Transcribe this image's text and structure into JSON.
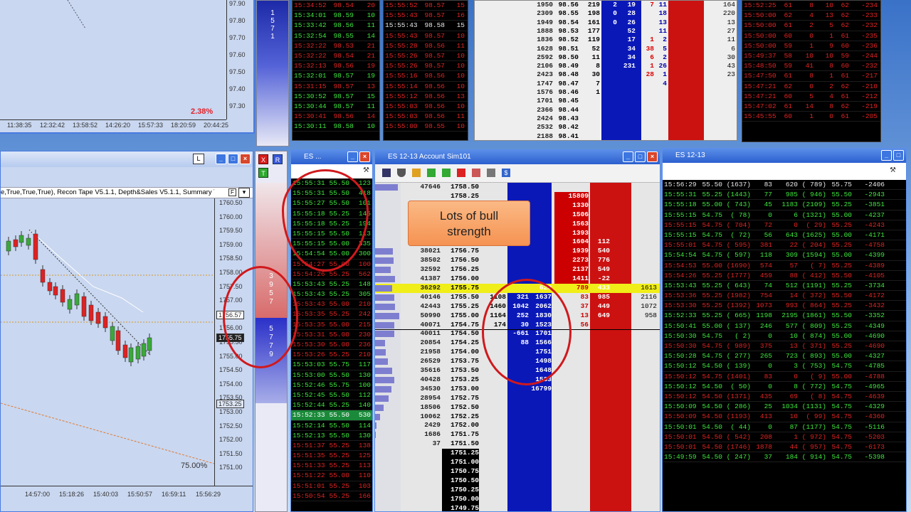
{
  "top_chart": {
    "prices": [
      "97.90",
      "97.80",
      "97.70",
      "97.60",
      "97.50",
      "97.40",
      "97.30"
    ],
    "times": [
      "11:38:35",
      "12:32:42",
      "13:58:52",
      "14:26:20",
      "15:57:33",
      "18:20:59",
      "20:44:25"
    ],
    "pct": "2.38%"
  },
  "top_tape_1": [
    [
      "15:34:52",
      "98.54",
      "20",
      "r"
    ],
    [
      "15:34:01",
      "98.59",
      "10",
      "g"
    ],
    [
      "15:33:42",
      "98.56",
      "11",
      "g"
    ],
    [
      "15:32:54",
      "98.55",
      "14",
      "g"
    ],
    [
      "15:32:22",
      "98.53",
      "21",
      "r"
    ],
    [
      "15:32:22",
      "98.54",
      "21",
      "r"
    ],
    [
      "15:32:13",
      "98.56",
      "19",
      "r"
    ],
    [
      "15:32:01",
      "98.57",
      "19",
      "g"
    ],
    [
      "15:31:15",
      "98.57",
      "13",
      "r"
    ],
    [
      "15:30:52",
      "98.57",
      "15",
      "g"
    ],
    [
      "15:30:44",
      "98.57",
      "11",
      "g"
    ],
    [
      "15:30:41",
      "98.56",
      "14",
      "r"
    ],
    [
      "15:30:11",
      "98.58",
      "10",
      "g"
    ]
  ],
  "top_tape_2": [
    [
      "15:55:52",
      "98.57",
      "15",
      "r"
    ],
    [
      "15:55:43",
      "98.57",
      "16",
      "r"
    ],
    [
      "15:55:43",
      "98.58",
      "15",
      "w"
    ],
    [
      "15:55:43",
      "98.57",
      "10",
      "r"
    ],
    [
      "15:55:28",
      "98.56",
      "11",
      "r"
    ],
    [
      "15:55:26",
      "98.57",
      "10",
      "r"
    ],
    [
      "15:55:26",
      "98.57",
      "10",
      "r"
    ],
    [
      "15:55:16",
      "98.56",
      "10",
      "r"
    ],
    [
      "15:55:14",
      "98.56",
      "10",
      "r"
    ],
    [
      "15:55:12",
      "98.56",
      "13",
      "r"
    ],
    [
      "15:55:03",
      "98.56",
      "10",
      "r"
    ],
    [
      "15:55:03",
      "98.56",
      "11",
      "r"
    ],
    [
      "15:55:00",
      "98.55",
      "10",
      "r"
    ]
  ],
  "top_ladder": [
    [
      "1950",
      "98.56",
      "219",
      "2",
      "19",
      "7",
      "11"
    ],
    [
      "2309",
      "98.55",
      "198",
      "0",
      "28",
      "",
      "18"
    ],
    [
      "1949",
      "98.54",
      "161",
      "0",
      "26",
      "",
      "13"
    ],
    [
      "1888",
      "98.53",
      "177",
      "",
      "52",
      "",
      "11"
    ],
    [
      "1836",
      "98.52",
      "119",
      "",
      "17",
      "1",
      "2"
    ],
    [
      "1628",
      "98.51",
      "52",
      "",
      "34",
      "38",
      "5"
    ],
    [
      "2592",
      "98.50",
      "11",
      "",
      "34",
      "6",
      "2"
    ],
    [
      "2106",
      "98.49",
      "8",
      "",
      "231",
      "1",
      "26"
    ],
    [
      "2423",
      "98.48",
      "30",
      "",
      "",
      "28",
      "1"
    ],
    [
      "1747",
      "98.47",
      "7",
      "",
      "",
      "",
      "4"
    ],
    [
      "1576",
      "98.46",
      "1",
      "",
      "",
      "",
      ""
    ],
    [
      "1701",
      "98.45",
      "",
      "",
      "",
      "",
      ""
    ],
    [
      "2366",
      "98.44",
      "",
      "",
      "",
      "",
      ""
    ],
    [
      "2424",
      "98.43",
      "",
      "",
      "",
      "",
      ""
    ],
    [
      "2532",
      "98.42",
      "",
      "",
      "",
      "",
      ""
    ],
    [
      "2188",
      "98.41",
      "",
      "",
      "",
      "",
      ""
    ]
  ],
  "top_ladder_right": [
    "164",
    "220",
    "13",
    "27",
    "11",
    "6",
    "30",
    "43",
    "23",
    "",
    "",
    "",
    "",
    ""
  ],
  "top_tape_3": [
    [
      "15:52:25",
      "61",
      "8",
      "10",
      "62",
      "-234"
    ],
    [
      "15:50:00",
      "62",
      "4",
      "13",
      "62",
      "-233"
    ],
    [
      "15:50:00",
      "61",
      "2",
      "5",
      "62",
      "-232"
    ],
    [
      "15:50:00",
      "60",
      "0",
      "1",
      "61",
      "-235"
    ],
    [
      "15:50:00",
      "59",
      "1",
      "9",
      "60",
      "-236"
    ],
    [
      "15:49:37",
      "58",
      "10",
      "10",
      "59",
      "-244"
    ],
    [
      "15:48:50",
      "59",
      "41",
      "8",
      "60",
      "-232"
    ],
    [
      "15:47:50",
      "61",
      "8",
      "1",
      "61",
      "-217"
    ],
    [
      "15:47:21",
      "62",
      "0",
      "2",
      "62",
      "-210"
    ],
    [
      "15:47:21",
      "60",
      "5",
      "4",
      "61",
      "-212"
    ],
    [
      "15:47:02",
      "61",
      "14",
      "8",
      "62",
      "-219"
    ],
    [
      "15:45:55",
      "60",
      "1",
      "0",
      "61",
      "-205"
    ]
  ],
  "chart": {
    "title_text": "e,True,True,True), Recon Tape V5.1.1, Depth&Sales V5.1.1, Summary Tap",
    "prices": [
      "1760.50",
      "1760.00",
      "1759.50",
      "1759.00",
      "1758.50",
      "1758.00",
      "1757.50",
      "1757.00",
      "1756.50",
      "1756.00",
      "1755.50",
      "1755.00",
      "1754.50",
      "1754.00",
      "1753.50",
      "1753.00",
      "1752.50",
      "1752.00",
      "1751.50",
      "1751.00"
    ],
    "last_label": "1756.57",
    "current_label": "1755.75",
    "mid_label": "1753.25",
    "times": [
      "14:57:00",
      "15:18:26",
      "15:40:03",
      "15:50:57",
      "16:59:11",
      "15:56:29"
    ],
    "pct": "75.00%",
    "l_button": "L"
  },
  "mini_bar": {
    "top_digits": [
      "1",
      "5",
      "7",
      "1"
    ],
    "red_digits": [
      "3",
      "9",
      "5",
      "7"
    ],
    "blue_digits": [
      "5",
      "7",
      "7",
      "9"
    ],
    "x_label": "X",
    "r_label": "R",
    "t_label": "T"
  },
  "tape_left": {
    "title": "ES ...",
    "rows": [
      [
        "15:55:31",
        "55.50",
        "123",
        "g"
      ],
      [
        "15:55:31",
        "55.50",
        "418",
        "g"
      ],
      [
        "15:55:27",
        "55.50",
        "101",
        "g"
      ],
      [
        "15:55:18",
        "55.25",
        "145",
        "g"
      ],
      [
        "15:55:18",
        "55.25",
        "194",
        "g"
      ],
      [
        "15:55:15",
        "55.50",
        "113",
        "g"
      ],
      [
        "15:55:15",
        "55.00",
        "335",
        "g"
      ],
      [
        "15:54:54",
        "55.00",
        "300",
        "g"
      ],
      [
        "15:54:27",
        "55.00",
        "100",
        "r"
      ],
      [
        "15:54:26",
        "55.25",
        "562",
        "r"
      ],
      [
        "15:53:43",
        "55.25",
        "148",
        "g"
      ],
      [
        "15:53:43",
        "55.25",
        "305",
        "g"
      ],
      [
        "15:53:43",
        "55.00",
        "210",
        "r"
      ],
      [
        "15:53:35",
        "55.25",
        "242",
        "r"
      ],
      [
        "15:53:35",
        "55.00",
        "215",
        "r"
      ],
      [
        "15:53:31",
        "55.00",
        "230",
        "r"
      ],
      [
        "15:53:30",
        "55.00",
        "236",
        "r"
      ],
      [
        "15:53:26",
        "55.25",
        "210",
        "r"
      ],
      [
        "15:53:03",
        "55.75",
        "117",
        "g"
      ],
      [
        "15:53:00",
        "55.50",
        "130",
        "g"
      ],
      [
        "15:52:46",
        "55.75",
        "100",
        "g"
      ],
      [
        "15:52:45",
        "55.50",
        "112",
        "g"
      ],
      [
        "15:52:44",
        "55.25",
        "140",
        "g"
      ],
      [
        "15:52:33",
        "55.50",
        "530",
        "hl"
      ],
      [
        "15:52:14",
        "55.50",
        "114",
        "g"
      ],
      [
        "15:52:13",
        "55.50",
        "130",
        "g"
      ],
      [
        "15:51:37",
        "55.25",
        "138",
        "r"
      ],
      [
        "15:51:35",
        "55.25",
        "125",
        "r"
      ],
      [
        "15:51:33",
        "55.25",
        "113",
        "r"
      ],
      [
        "15:51:22",
        "55.00",
        "110",
        "r"
      ],
      [
        "15:51:01",
        "55.25",
        "103",
        "r"
      ],
      [
        "15:50:54",
        "55.25",
        "166",
        "r"
      ]
    ]
  },
  "dom": {
    "title": "ES 12-13  Account Sim101",
    "note_line1": "Lots of bull",
    "note_line2": "strength",
    "rows": [
      [
        "47646",
        "1758.50",
        "",
        "",
        "",
        "",
        ""
      ],
      [
        "",
        "1758.25",
        "",
        "",
        "",
        "15809",
        ""
      ],
      [
        "",
        "1758.00",
        "",
        "",
        "",
        "1330",
        ""
      ],
      [
        "",
        "1757.75",
        "",
        "",
        "",
        "1506",
        ""
      ],
      [
        "",
        "1757.50",
        "",
        "",
        "",
        "1563",
        ""
      ],
      [
        "",
        "1757.25",
        "",
        "",
        "",
        "1393",
        ""
      ],
      [
        "",
        "1757.00",
        "",
        "",
        "",
        "1604",
        "112"
      ],
      [
        "38021",
        "1756.75",
        "",
        "",
        "",
        "1939",
        "540"
      ],
      [
        "38502",
        "1756.50",
        "",
        "",
        "",
        "2273",
        "776"
      ],
      [
        "32592",
        "1756.25",
        "",
        "",
        "",
        "2137",
        "549"
      ],
      [
        "41387",
        "1756.00",
        "",
        "",
        "",
        "1411",
        "-22"
      ],
      [
        "36292",
        "1755.75",
        "",
        "",
        "620",
        "789",
        "433"
      ],
      [
        "40146",
        "1755.50",
        "1108",
        "321",
        "1637",
        "83",
        "985"
      ],
      [
        "42443",
        "1755.25",
        "1460",
        "1042",
        "2062",
        "37",
        "449"
      ],
      [
        "50990",
        "1755.00",
        "1164",
        "252",
        "1830",
        "13",
        "649"
      ],
      [
        "40071",
        "1754.75",
        "174",
        "30",
        "1523",
        "56",
        ""
      ],
      [
        "40011",
        "1754.50",
        "",
        "-661",
        "1701",
        "",
        ""
      ],
      [
        "20854",
        "1754.25",
        "",
        "88",
        "1566",
        "",
        ""
      ],
      [
        "21958",
        "1754.00",
        "",
        "",
        "1751",
        "",
        ""
      ],
      [
        "26529",
        "1753.75",
        "",
        "",
        "1498",
        "",
        ""
      ],
      [
        "35616",
        "1753.50",
        "",
        "",
        "1648",
        "",
        ""
      ],
      [
        "40428",
        "1753.25",
        "",
        "",
        "1533",
        "",
        ""
      ],
      [
        "34530",
        "1753.00",
        "",
        "",
        "16799",
        "",
        ""
      ],
      [
        "28954",
        "1752.75",
        "",
        "",
        "",
        "",
        ""
      ],
      [
        "18506",
        "1752.50",
        "",
        "",
        "",
        "",
        ""
      ],
      [
        "10062",
        "1752.25",
        "",
        "",
        "",
        "",
        ""
      ],
      [
        "2429",
        "1752.00",
        "",
        "",
        "",
        "",
        ""
      ],
      [
        "1686",
        "1751.75",
        "",
        "",
        "",
        "",
        ""
      ],
      [
        "37",
        "1751.50",
        "",
        "",
        "",
        "",
        ""
      ],
      [
        "",
        "1751.25",
        "",
        "",
        "",
        "",
        ""
      ],
      [
        "",
        "1751.00",
        "",
        "",
        "",
        "",
        ""
      ],
      [
        "",
        "1750.75",
        "",
        "",
        "",
        "",
        ""
      ],
      [
        "",
        "1750.50",
        "",
        "",
        "",
        "",
        ""
      ],
      [
        "",
        "1750.25",
        "",
        "",
        "",
        "",
        ""
      ],
      [
        "",
        "1750.00",
        "",
        "",
        "",
        "",
        ""
      ],
      [
        "",
        "1749.75",
        "",
        "",
        "",
        "",
        ""
      ]
    ],
    "right_vals": [
      "1613",
      "2116",
      "1072",
      "958"
    ]
  },
  "tape_right": {
    "title": "ES 12-13",
    "rows": [
      [
        "15:56:29",
        "55.50",
        "(1637)",
        "83",
        "620",
        "( 789)",
        "55.75",
        "-2406",
        "w"
      ],
      [
        "15:55:31",
        "55.25",
        "(1443)",
        "77",
        "985",
        "( 946)",
        "55.50",
        "-2943",
        "g"
      ],
      [
        "15:55:18",
        "55.00",
        "( 743)",
        "45",
        "1183",
        "(2109)",
        "55.25",
        "-3851",
        "g"
      ],
      [
        "15:55:15",
        "54.75",
        "(  78)",
        "0",
        "6",
        "(1321)",
        "55.00",
        "-4237",
        "g"
      ],
      [
        "15:55:15",
        "54.75",
        "( 704)",
        "72",
        "0",
        "(  29)",
        "55.25",
        "-4243",
        "r"
      ],
      [
        "15:55:15",
        "54.75",
        "(  72)",
        "56",
        "643",
        "(1625)",
        "55.00",
        "-4171",
        "g"
      ],
      [
        "15:55:01",
        "54.75",
        "( 595)",
        "381",
        "22",
        "( 204)",
        "55.25",
        "-4758",
        "r"
      ],
      [
        "15:54:54",
        "54.75",
        "( 597)",
        "118",
        "309",
        "(1594)",
        "55.00",
        "-4399",
        "g"
      ],
      [
        "15:54:53",
        "55.00",
        "(1690)",
        "574",
        "57",
        "(   7)",
        "55.25",
        "-4389",
        "r"
      ],
      [
        "15:54:26",
        "55.25",
        "(1777)",
        "459",
        "88",
        "( 412)",
        "55.50",
        "-4105",
        "r"
      ],
      [
        "15:53:43",
        "55.25",
        "( 643)",
        "74",
        "512",
        "(1191)",
        "55.25",
        "-3734",
        "g"
      ],
      [
        "15:53:36",
        "55.25",
        "(1982)",
        "754",
        "14",
        "( 372)",
        "55.50",
        "-4172",
        "r"
      ],
      [
        "15:53:30",
        "55.25",
        "(1392)",
        "1073",
        "993",
        "( 864)",
        "55.25",
        "-3432",
        "r"
      ],
      [
        "15:52:33",
        "55.25",
        "( 665)",
        "1198",
        "2195",
        "(1861)",
        "55.50",
        "-3352",
        "g"
      ],
      [
        "15:50:41",
        "55.00",
        "( 137)",
        "246",
        "577",
        "( 809)",
        "55.25",
        "-4349",
        "g"
      ],
      [
        "15:50:30",
        "54.75",
        "(   2)",
        "0",
        "10",
        "( 874)",
        "55.00",
        "-4690",
        "g"
      ],
      [
        "15:50:30",
        "54.75",
        "( 989)",
        "375",
        "13",
        "( 371)",
        "55.25",
        "-4690",
        "r"
      ],
      [
        "15:50:28",
        "54.75",
        "( 277)",
        "265",
        "723",
        "( 893)",
        "55.00",
        "-4327",
        "g"
      ],
      [
        "15:50:12",
        "54.50",
        "( 139)",
        "0",
        "3",
        "( 753)",
        "54.75",
        "-4785",
        "g"
      ],
      [
        "15:50:12",
        "54.75",
        "(1401)",
        "83",
        "0",
        "(  9)",
        "55.00",
        "-4788",
        "r"
      ],
      [
        "15:50:12",
        "54.50",
        "(  50)",
        "0",
        "8",
        "( 772)",
        "54.75",
        "-4965",
        "g"
      ],
      [
        "15:50:12",
        "54.50",
        "(1371)",
        "435",
        "69",
        "(   8)",
        "54.75",
        "-4639",
        "r"
      ],
      [
        "15:50:09",
        "54.50",
        "( 286)",
        "25",
        "1034",
        "(1131)",
        "54.75",
        "-4329",
        "g"
      ],
      [
        "15:50:09",
        "54.50",
        "(1193)",
        "413",
        "10",
        "(  99)",
        "54.75",
        "-4360",
        "r"
      ],
      [
        "15:50:01",
        "54.50",
        "(  44)",
        "0",
        "87",
        "(1177)",
        "54.75",
        "-5116",
        "g"
      ],
      [
        "15:50:01",
        "54.50",
        "( 542)",
        "208",
        "1",
        "( 972)",
        "54.75",
        "-5203",
        "r"
      ],
      [
        "15:50:01",
        "54.50",
        "(1746)",
        "1878",
        "44",
        "( 957)",
        "54.75",
        "-6173",
        "r"
      ],
      [
        "15:49:59",
        "54.50",
        "( 247)",
        "37",
        "184",
        "( 914)",
        "54.75",
        "-5398",
        "g"
      ]
    ]
  }
}
